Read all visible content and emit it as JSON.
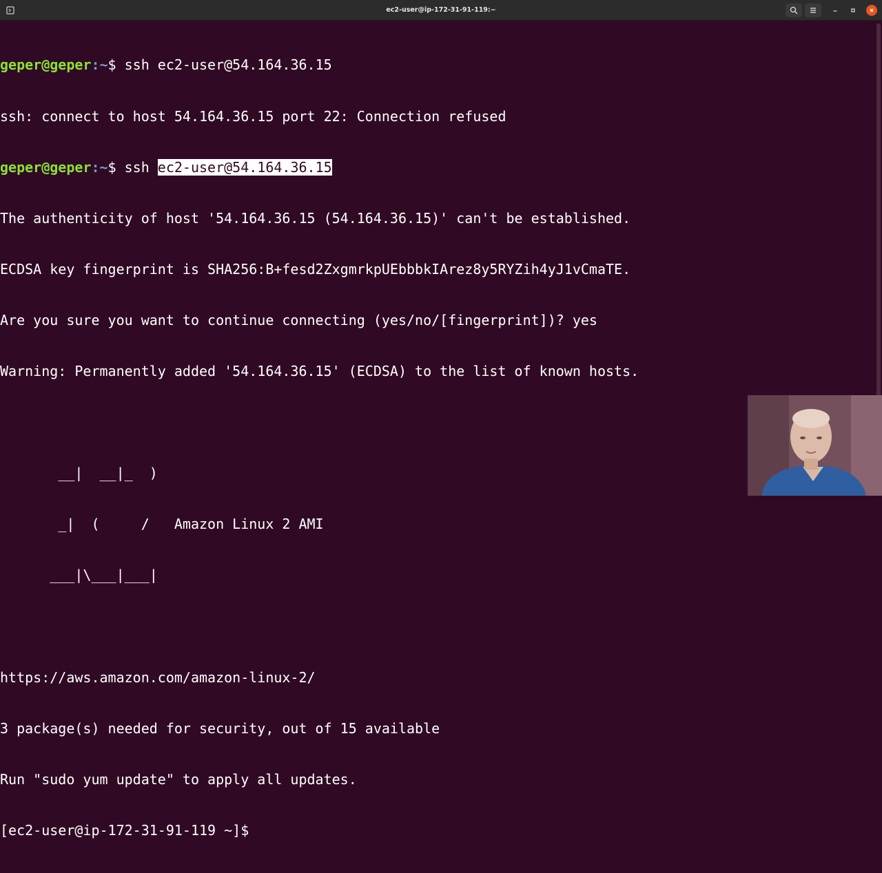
{
  "window": {
    "title": "ec2-user@ip-172-31-91-119:~"
  },
  "terminal": {
    "lines": [
      {
        "user": "geper@geper",
        "path": ":~",
        "cmd": "$ ssh ec2-user@54.164.36.15"
      },
      {
        "text": "ssh: connect to host 54.164.36.15 port 22: Connection refused"
      },
      {
        "user": "geper@geper",
        "path": ":~",
        "cmd": "$ ssh ",
        "selected": "ec2-user@54.164.36.15"
      },
      {
        "text": "The authenticity of host '54.164.36.15 (54.164.36.15)' can't be established."
      },
      {
        "text": "ECDSA key fingerprint is SHA256:B+fesd2ZxgmrkpUEbbbkIArez8y5RYZih4yJ1vCmaTE."
      },
      {
        "text": "Are you sure you want to continue connecting (yes/no/[fingerprint])? yes"
      },
      {
        "text": "Warning: Permanently added '54.164.36.15' (ECDSA) to the list of known hosts."
      },
      {
        "text": ""
      },
      {
        "text": "       __|  __|_  )"
      },
      {
        "text": "       _|  (     /   Amazon Linux 2 AMI"
      },
      {
        "text": "      ___|\\___|___|"
      },
      {
        "text": ""
      },
      {
        "text": "https://aws.amazon.com/amazon-linux-2/"
      },
      {
        "text": "3 package(s) needed for security, out of 15 available"
      },
      {
        "text": "Run \"sudo yum update\" to apply all updates."
      },
      {
        "text": "[ec2-user@ip-172-31-91-119 ~]$ "
      }
    ]
  },
  "colors": {
    "background": "#300a24",
    "prompt_user": "#8ae234",
    "prompt_path": "#729fcf",
    "close_button": "#e95420"
  },
  "icons": {
    "new_tab": "new-tab-icon",
    "search": "search-icon",
    "menu": "hamburger-menu-icon",
    "minimize": "minimize-icon",
    "maximize": "maximize-icon",
    "close": "close-icon"
  }
}
